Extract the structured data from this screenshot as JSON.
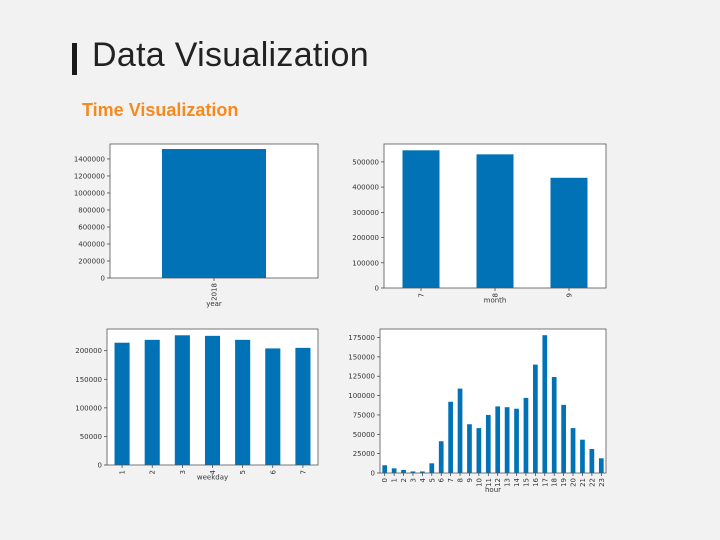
{
  "slide": {
    "title": "Data Visualization",
    "subtitle": "Time Visualization"
  },
  "colors": {
    "bar": "#0072b5",
    "accent": "#f58a1f",
    "plot_bg": "#ffffff",
    "page_bg": "#f2f2f2"
  },
  "chart_data": [
    {
      "id": "year",
      "type": "bar",
      "xlabel": "year",
      "categories": [
        "2018"
      ],
      "values": [
        1517000
      ],
      "ylim": [
        0,
        1576000
      ],
      "yticks": [
        0,
        200000,
        400000,
        600000,
        800000,
        1000000,
        1200000,
        1400000
      ],
      "grid": false
    },
    {
      "id": "month",
      "type": "bar",
      "xlabel": "month",
      "categories": [
        "7",
        "8",
        "9"
      ],
      "values": [
        546000,
        530000,
        437000
      ],
      "ylim": [
        0,
        571000
      ],
      "yticks": [
        0,
        100000,
        200000,
        300000,
        400000,
        500000
      ],
      "grid": false
    },
    {
      "id": "weekday",
      "type": "bar",
      "xlabel": "weekday",
      "categories": [
        "1",
        "2",
        "3",
        "4",
        "5",
        "6",
        "7"
      ],
      "values": [
        214000,
        219000,
        227000,
        226000,
        219000,
        204000,
        205000
      ],
      "ylim": [
        0,
        238000
      ],
      "yticks": [
        0,
        50000,
        100000,
        150000,
        200000
      ],
      "grid": false
    },
    {
      "id": "hour",
      "type": "bar",
      "xlabel": "hour",
      "categories": [
        "0",
        "1",
        "2",
        "3",
        "4",
        "5",
        "6",
        "7",
        "8",
        "9",
        "10",
        "11",
        "12",
        "13",
        "14",
        "15",
        "16",
        "17",
        "18",
        "19",
        "20",
        "21",
        "22",
        "23"
      ],
      "values": [
        10000,
        6000,
        4000,
        2000,
        2000,
        12500,
        41000,
        92000,
        109000,
        63000,
        58000,
        75000,
        86000,
        85000,
        83000,
        97000,
        140000,
        178000,
        124000,
        88000,
        58000,
        43000,
        31000,
        19000
      ],
      "ylim": [
        0,
        186000
      ],
      "yticks": [
        0,
        25000,
        50000,
        75000,
        100000,
        125000,
        150000,
        175000
      ],
      "grid": false
    }
  ]
}
